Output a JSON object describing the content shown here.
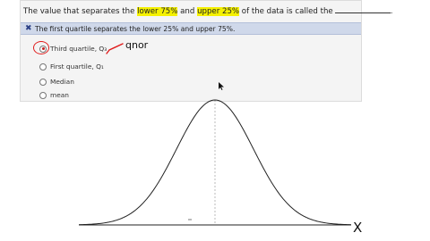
{
  "question": {
    "prefix": "The value that separates the ",
    "highlight1": "lower 75%",
    "mid": " and ",
    "highlight2": "upper 25%",
    "suffix": " of the data is called the"
  },
  "feedback": {
    "icon": "x-mark-icon",
    "text": "The first quartile separates the lower 25% and upper 75%."
  },
  "options": [
    {
      "label": "Third quartile, Q₃",
      "selected": true
    },
    {
      "label": "First quartile, Q₁",
      "selected": false
    },
    {
      "label": "Median",
      "selected": false
    },
    {
      "label": "mean",
      "selected": false
    }
  ],
  "annotations": {
    "handwritten_note": "qnor",
    "axis_label": "X"
  },
  "colors": {
    "highlight": "#f5f100",
    "feedback_bar": "#cfd8ea",
    "annotation_red": "#e01b1b"
  }
}
